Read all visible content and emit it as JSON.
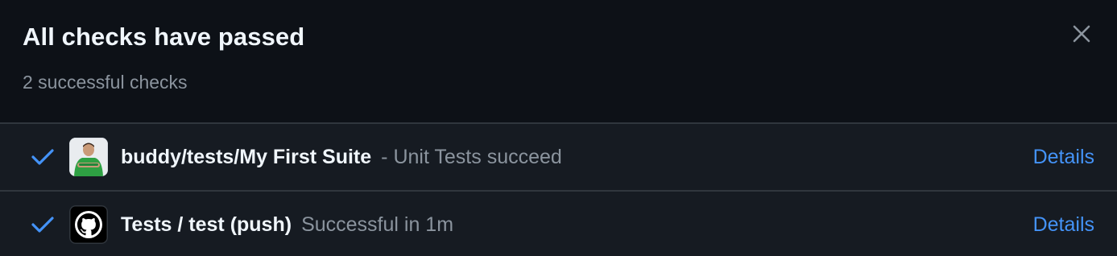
{
  "header": {
    "title": "All checks have passed",
    "subtitle": "2 successful checks",
    "close_icon": "close-icon"
  },
  "checks": [
    {
      "status_icon": "check-icon",
      "avatar_icon": "buddy-avatar",
      "name": "buddy/tests/My First Suite",
      "description": "- Unit Tests succeed",
      "details_label": "Details"
    },
    {
      "status_icon": "check-icon",
      "avatar_icon": "github-logo-icon",
      "name": "Tests / test (push)",
      "description": "Successful in 1m",
      "details_label": "Details"
    }
  ],
  "colors": {
    "background": "#0d1117",
    "row_background": "#161b22",
    "success": "#4493f8",
    "link": "#4493f8",
    "muted_text": "#8b949e",
    "border": "#30363d"
  }
}
